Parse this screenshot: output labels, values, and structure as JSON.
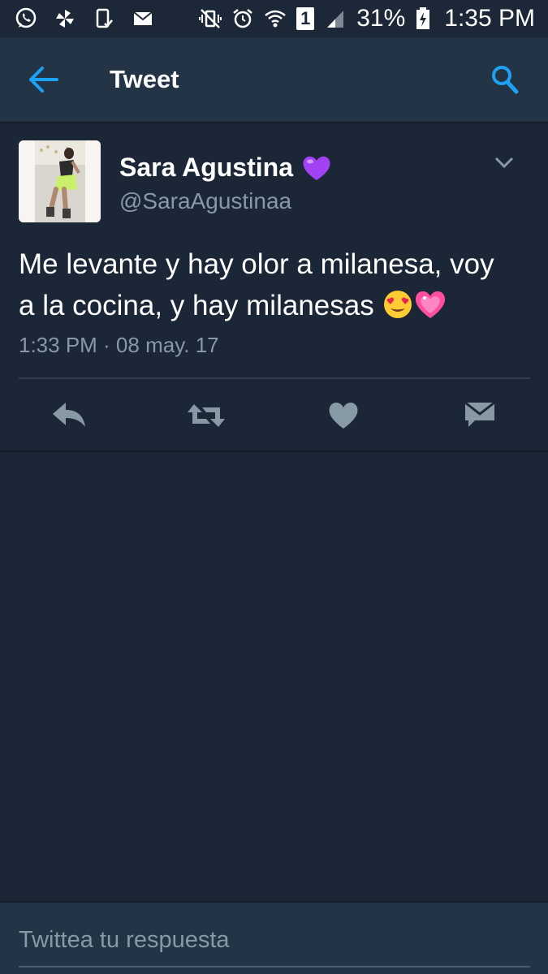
{
  "status_bar": {
    "left_icons": [
      "whatsapp-icon",
      "pinwheel-icon",
      "phone-check-icon",
      "mail-icon"
    ],
    "right_icons": [
      "vibrate-mute-icon",
      "alarm-icon",
      "wifi-icon",
      "sim-1-icon",
      "signal-icon",
      "battery-charging-icon"
    ],
    "sim_label": "1",
    "battery": "31%",
    "time": "1:35 PM"
  },
  "app_bar": {
    "title": "Tweet",
    "back_icon": "back-arrow-icon",
    "search_icon": "search-icon"
  },
  "tweet": {
    "display_name": "Sara Agustina",
    "name_emoji": "purple-heart-icon",
    "handle": "@SaraAgustinaa",
    "text_line1": "Me levante y hay olor a milanesa, voy",
    "text_line2": "a la cocina, y hay milanesas",
    "emojis": [
      "heart-eyes-emoji",
      "sparkling-heart-emoji"
    ],
    "timestamp": "1:33 PM · 08 may. 17",
    "actions": [
      "reply-icon",
      "retweet-icon",
      "like-icon",
      "direct-message-icon"
    ]
  },
  "reply": {
    "placeholder": "Twittea tu respuesta"
  },
  "colors": {
    "background": "#1b2636",
    "app_bar": "#243447",
    "accent_blue": "#1da1f2",
    "secondary_text": "#8899a6",
    "purple_heart": "#a142f4",
    "pink_heart": "#ff4fa3"
  }
}
